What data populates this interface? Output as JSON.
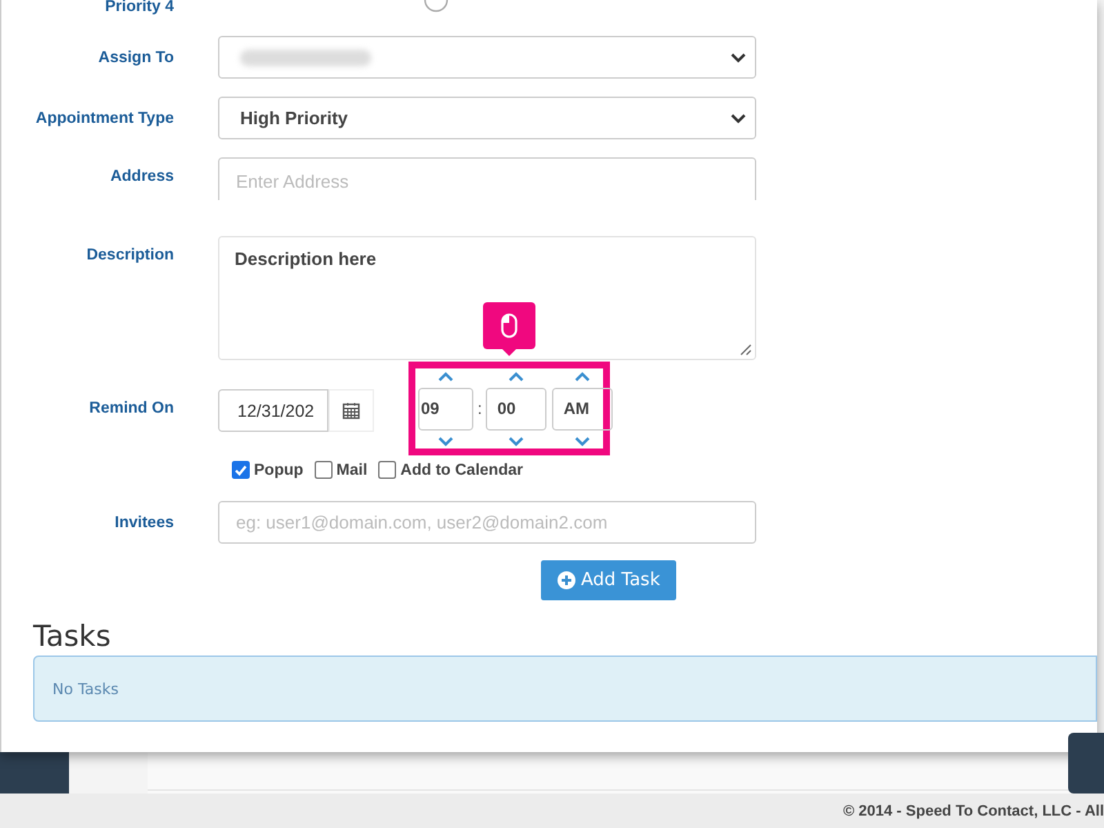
{
  "form": {
    "top_label": "Priority 4",
    "rows": [
      {
        "kind": "redacted-select",
        "label": "Assign To"
      },
      {
        "kind": "select",
        "label": "Appointment Type",
        "value": "High Priority"
      },
      {
        "kind": "input",
        "label": "Address",
        "placeholder": "Enter Address"
      },
      {
        "kind": "textarea",
        "label": "Description",
        "value": "Description here"
      }
    ],
    "remind": {
      "label": "Remind On",
      "date": "12/31/202",
      "hour": "09",
      "separator": ":",
      "minute": "00",
      "period": "AM"
    },
    "checkboxes": [
      {
        "label": "Popup",
        "checked": true
      },
      {
        "label": "Mail",
        "checked": false
      },
      {
        "label": "Add to Calendar",
        "checked": false
      }
    ],
    "invitees": {
      "label": "Invitees",
      "placeholder": "eg: user1@domain.com, user2@domain2.com"
    },
    "add_button": "Add Task"
  },
  "tasks": {
    "title": "Tasks",
    "empty_message": "No Tasks"
  },
  "footer": "© 2014 - Speed To Contact, LLC - All"
}
